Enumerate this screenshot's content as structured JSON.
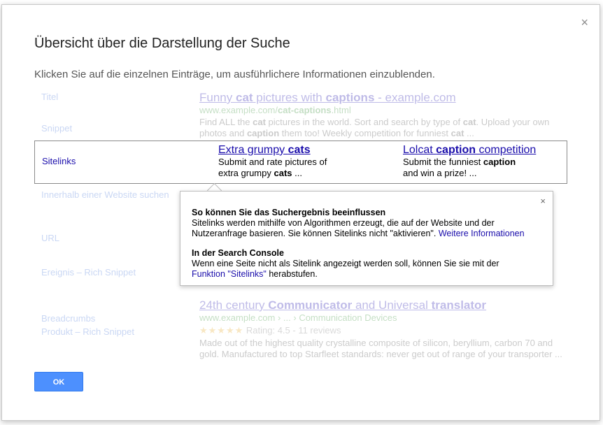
{
  "dialog": {
    "title": "Übersicht über die Darstellung der Suche",
    "subtitle": "Klicken Sie auf die einzelnen Einträge, um ausführlichere Informationen einzublenden.",
    "close_label": "×",
    "ok_label": "OK"
  },
  "labels": {
    "titel": "Titel",
    "snippet": "Snippet",
    "sitelinks": "Sitelinks",
    "site_search": "Innerhalb einer Website suchen",
    "url": "URL",
    "event": "Ereignis – Rich Snippet",
    "breadcrumbs": "Breadcrumbs",
    "product": "Produkt – Rich Snippet"
  },
  "result1": {
    "title_a": "Funny ",
    "title_b": "cat",
    "title_c": " pictures with ",
    "title_d": "captions",
    "title_e": " - example.com",
    "url_a": "www.example.com/",
    "url_b": "cat-captions",
    "url_c": ".html",
    "snip_1": "Find ALL the ",
    "snip_2": "cat",
    "snip_3": " pictures in the world. Sort and search by type of ",
    "snip_4": "cat",
    "snip_5": ". Upload your own photos and ",
    "snip_6": "caption",
    "snip_7": " them too! Weekly competition for funniest ",
    "snip_8": "cat",
    "snip_9": " ..."
  },
  "sitelinks": {
    "link1_a": "Extra grumpy ",
    "link1_b": "cats",
    "link1_desc_a": "Submit and rate pictures of",
    "link1_desc_b": "extra grumpy ",
    "link1_desc_c": "cats",
    "link1_desc_d": " ...",
    "link2_a": "Lolcat ",
    "link2_b": "caption",
    "link2_c": " competition",
    "link2_desc_a": "Submit the funniest ",
    "link2_desc_b": "caption",
    "link2_desc_c": "and win a prize! ..."
  },
  "popup": {
    "close_label": "×",
    "heading1": "So können Sie das Suchergebnis beeinflussen",
    "text1": "Sitelinks werden mithilfe von Algorithmen erzeugt, die auf der Website und der Nutzeranfrage basieren. Sie können Sitelinks nicht \"aktivieren\".",
    "link1": "Weitere Informationen",
    "heading2": "In der Search Console",
    "text2": "Wenn eine Seite nicht als Sitelink angezeigt werden soll, können Sie sie mit der",
    "link2": "Funktion \"Sitelinks\"",
    "text2_end": " herabstufen."
  },
  "result2": {
    "title_a": "24th century ",
    "title_b": "Communicator",
    "title_c": " and Universal ",
    "title_d": "translator",
    "url_a": "www.example.com › ... › ",
    "url_b": "Communication Devices",
    "stars": "★★★★★",
    "rating": " Rating: 4.5 - 11 reviews",
    "snippet": "Made out of the highest quality crystalline composite of silicon, beryllium, carbon 70 and gold. Manufactured to top Starfleet standards: never get out of range of your transporter ..."
  },
  "colors": {
    "accent_blue": "#4d90fe",
    "link_blue": "#1a0dab",
    "url_green": "#2e8b2e",
    "star_orange": "#e7a928"
  }
}
